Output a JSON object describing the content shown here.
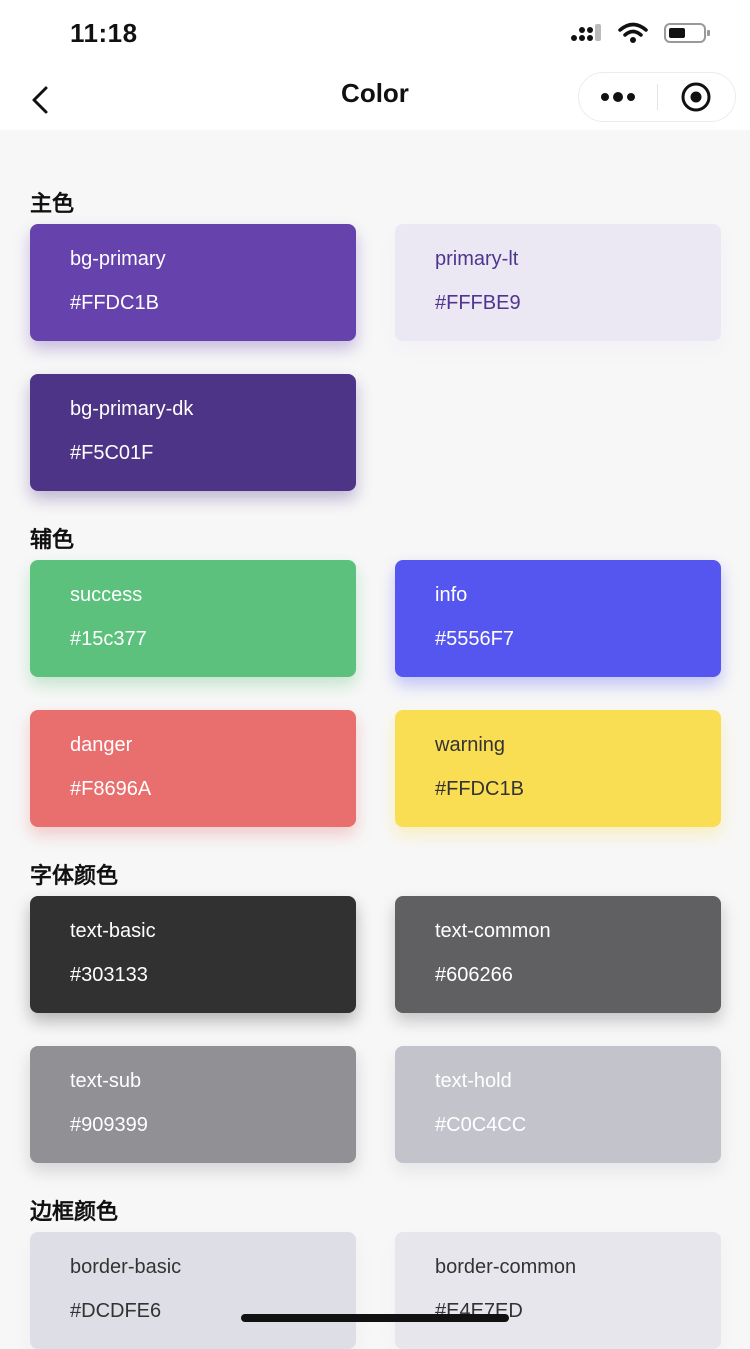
{
  "status_bar": {
    "time": "11:18"
  },
  "nav": {
    "title": "Color"
  },
  "sections": [
    {
      "title": "主色",
      "cards": [
        {
          "name": "bg-primary",
          "code": "#FFDC1B",
          "bg": "#6542AC",
          "fg": "#ffffff"
        },
        {
          "name": "primary-lt",
          "code": "#FFFBE9",
          "bg": "#EBE7F3",
          "fg": "#4F3590"
        },
        {
          "name": "bg-primary-dk",
          "code": "#F5C01F",
          "bg": "#4E3487",
          "fg": "#ffffff"
        }
      ]
    },
    {
      "title": "辅色",
      "cards": [
        {
          "name": "success",
          "code": "#15c377",
          "bg": "#5BC17C",
          "fg": "#ffffff"
        },
        {
          "name": "info",
          "code": "#5556F7",
          "bg": "#5556EF",
          "fg": "#ffffff"
        },
        {
          "name": "danger",
          "code": "#F8696A",
          "bg": "#E86F6E",
          "fg": "#ffffff"
        },
        {
          "name": "warning",
          "code": "#FFDC1B",
          "bg": "#F9DD52",
          "fg": "#333333"
        }
      ]
    },
    {
      "title": "字体颜色",
      "cards": [
        {
          "name": "text-basic",
          "code": "#303133",
          "bg": "#313131",
          "fg": "#ffffff"
        },
        {
          "name": "text-common",
          "code": "#606266",
          "bg": "#606062",
          "fg": "#ffffff"
        },
        {
          "name": "text-sub",
          "code": "#909399",
          "bg": "#909095",
          "fg": "#ffffff"
        },
        {
          "name": "text-hold",
          "code": "#C0C4CC",
          "bg": "#C3C3CB",
          "fg": "#ffffff"
        }
      ]
    },
    {
      "title": "边框颜色",
      "cards": [
        {
          "name": "border-basic",
          "code": "#DCDFE6",
          "bg": "#DEDEE6",
          "fg": "#333333"
        },
        {
          "name": "border-common",
          "code": "#E4E7ED",
          "bg": "#E6E6EC",
          "fg": "#333333"
        }
      ]
    }
  ]
}
